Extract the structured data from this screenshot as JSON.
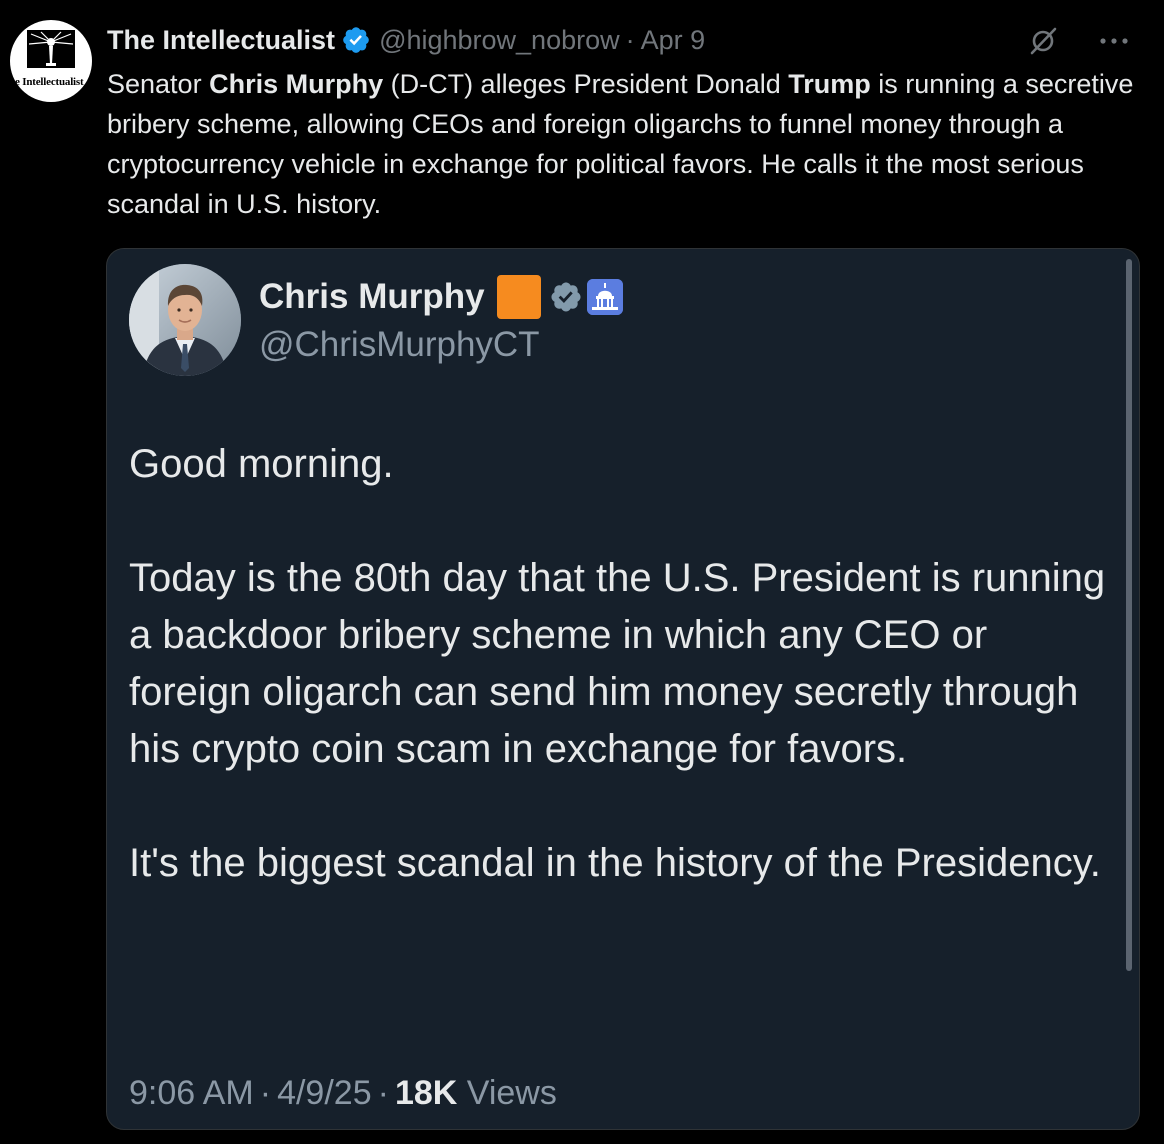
{
  "tweet": {
    "avatar_text": "The Intellectualist",
    "display_name": "The Intellectualist",
    "handle": "@highbrow_nobrow",
    "separator": "·",
    "date": "Apr 9",
    "text": {
      "p1": "Senator ",
      "b1": "Chris Murphy",
      "p2": " (D-CT) alleges President Donald ",
      "b2": "Trump",
      "p3": " is running a secretive bribery scheme, allowing CEOs and foreign oligarchs to funnel money through a cryptocurrency vehicle in exchange for political favors. He calls it the most serious scandal in U.S. history."
    },
    "icons": {
      "verified": "verified-badge-icon",
      "grok": "grok-icon",
      "more": "more-options-icon"
    },
    "colors": {
      "verified_blue": "#1d9bf0",
      "background": "#000000"
    }
  },
  "quote": {
    "display_name": "Chris Murphy",
    "handle": "@ChrisMurphyCT",
    "badges": [
      "orange-square-emoji",
      "gray-verified-icon",
      "capitol-emoji-icon"
    ],
    "body": {
      "line1": "Good morning.",
      "para2": "Today is the 80th day that the U.S. President is running a backdoor bribery scheme in which any CEO or foreign oligarch can send him money secretly through his crypto coin scam in exchange for favors.",
      "para3": "It's the biggest scandal in the history of the Presidency."
    },
    "meta": {
      "time": "9:06 AM",
      "sep1": "·",
      "date": "4/9/25",
      "sep2": "·",
      "views_count": "18K",
      "views_label": " Views"
    },
    "colors": {
      "card_background": "#16202b",
      "orange": "#f68b1f"
    }
  }
}
